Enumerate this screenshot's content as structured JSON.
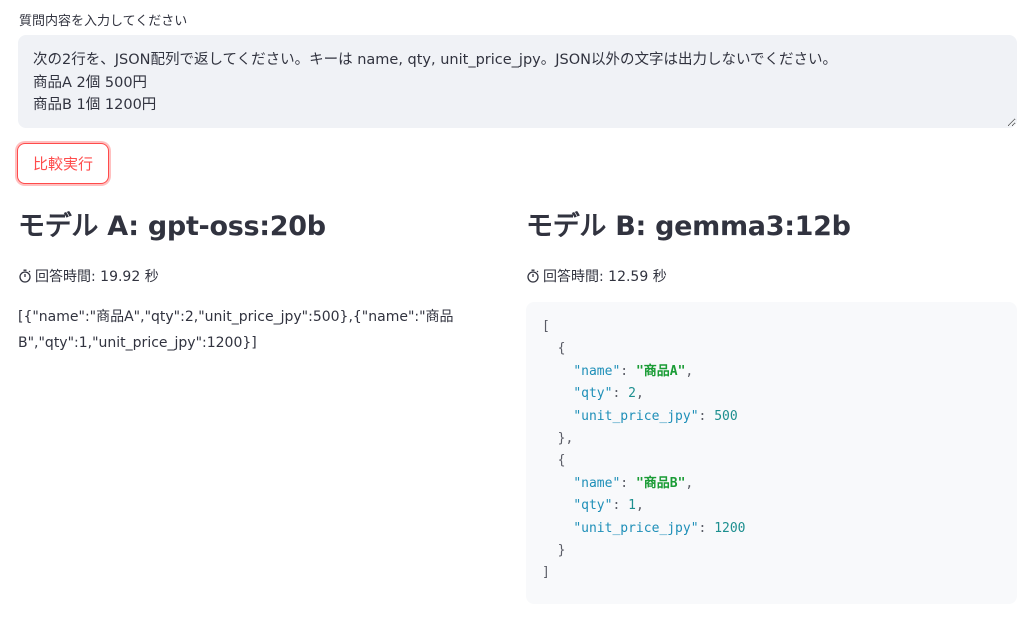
{
  "input": {
    "label": "質問内容を入力してください",
    "value": "次の2行を、JSON配列で返してください。キーは name, qty, unit_price_jpy。JSON以外の文字は出力しないでください。\n商品A 2個 500円\n商品B 1個 1200円"
  },
  "compare_button": {
    "label": "比較実行",
    "color": "#ff4b4b"
  },
  "model_a": {
    "title": "モデル A: gpt-oss:20b",
    "time_label": "回答時間: 19.92 秒",
    "answer": "[{\"name\":\"商品A\",\"qty\":2,\"unit_price_jpy\":500},{\"name\":\"商品B\",\"qty\":1,\"unit_price_jpy\":1200}]"
  },
  "model_b": {
    "title": "モデル B: gemma3:12b",
    "time_label": "回答時間: 12.59 秒",
    "code": {
      "open_bracket": "[",
      "close_bracket": "]",
      "items": [
        {
          "name_key": "\"name\"",
          "name_val": "\"商品A\"",
          "qty_key": "\"qty\"",
          "qty_val": "2",
          "price_key": "\"unit_price_jpy\"",
          "price_val": "500",
          "close": "},"
        },
        {
          "name_key": "\"name\"",
          "name_val": "\"商品B\"",
          "qty_key": "\"qty\"",
          "qty_val": "1",
          "price_key": "\"unit_price_jpy\"",
          "price_val": "1200",
          "close": "}"
        }
      ]
    }
  },
  "icons": {
    "timer": "stopwatch-icon"
  },
  "colors": {
    "accent": "#ff4b4b",
    "input_bg": "#f0f2f6",
    "code_bg": "#f8f9fb",
    "json_key": "#1e8fb8",
    "json_string": "#1a9c35",
    "json_number": "#1d8f8f"
  }
}
